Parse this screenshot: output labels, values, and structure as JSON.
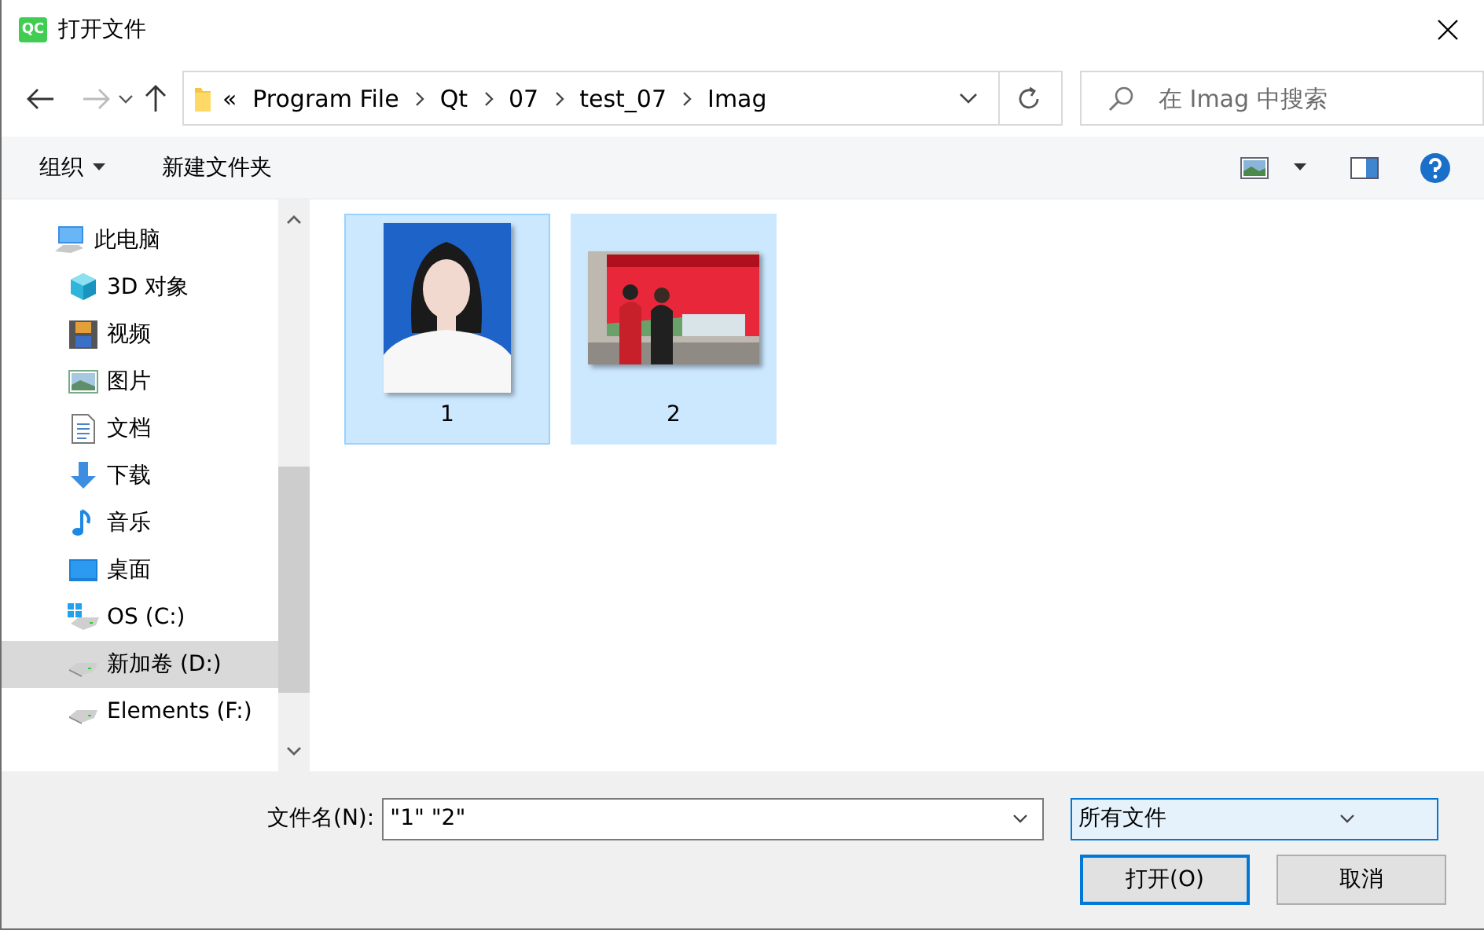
{
  "window": {
    "title": "打开文件",
    "app_icon_text": "QC"
  },
  "address": {
    "overflow": "«",
    "path": [
      "Program File",
      "Qt",
      "07",
      "test_07",
      "Imag"
    ]
  },
  "search": {
    "placeholder": "在 Imag 中搜索"
  },
  "toolbar": {
    "organize": "组织",
    "new_folder": "新建文件夹"
  },
  "sidebar": {
    "items": [
      {
        "label": "此电脑",
        "kind": "pc",
        "selected": false,
        "children": [
          {
            "label": "3D 对象",
            "kind": "cube",
            "selected": false
          },
          {
            "label": "视频",
            "kind": "film",
            "selected": false
          },
          {
            "label": "图片",
            "kind": "pictures",
            "selected": false
          },
          {
            "label": "文档",
            "kind": "document",
            "selected": false
          },
          {
            "label": "下载",
            "kind": "download",
            "selected": false
          },
          {
            "label": "音乐",
            "kind": "music",
            "selected": false
          },
          {
            "label": "桌面",
            "kind": "desktop",
            "selected": false
          },
          {
            "label": "OS (C:)",
            "kind": "osdrive",
            "selected": false
          },
          {
            "label": "新加卷 (D:)",
            "kind": "drive",
            "selected": true
          },
          {
            "label": "Elements (F:)",
            "kind": "drive",
            "selected": false
          }
        ]
      }
    ]
  },
  "files": [
    {
      "name": "1",
      "selected": true,
      "focused": true
    },
    {
      "name": "2",
      "selected": true,
      "focused": false
    }
  ],
  "footer": {
    "filename_label": "文件名(N):",
    "filename_value": "\"1\" \"2\"",
    "filetype": "所有文件",
    "buttons": [
      {
        "label": "打开(O)",
        "default": true
      },
      {
        "label": "取消",
        "default": false
      }
    ]
  }
}
